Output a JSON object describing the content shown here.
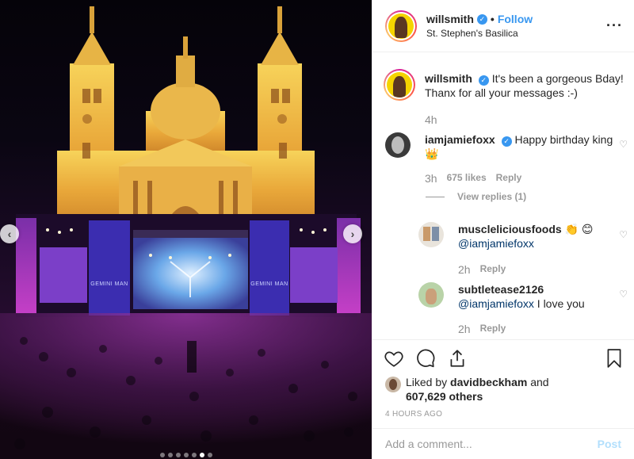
{
  "post": {
    "username": "willsmith",
    "follow_label": "Follow",
    "separator": "•",
    "location": "St. Stephen's Basilica",
    "more_label": "···"
  },
  "photo": {
    "stage_left_banner": "GEMINI MAN",
    "stage_right_banner": "GEMINI MAN",
    "slide_count": 7,
    "active_slide": 6,
    "prev_arrow": "‹",
    "next_arrow": "›"
  },
  "caption": {
    "username": "willsmith",
    "text": "It's been a gorgeous Bday! Thanx for all your messages :-)",
    "time": "4h"
  },
  "comments": [
    {
      "username": "iamjamiefoxx",
      "text": "Happy birthday king 👑",
      "time": "3h",
      "likes": "675 likes",
      "reply_label": "Reply",
      "view_replies": "View replies (1)"
    },
    {
      "username": "muscleliciousfoods",
      "text_emoji": "👏 😊",
      "mention": "@iamjamiefoxx",
      "time": "2h",
      "reply_label": "Reply"
    },
    {
      "username": "subtletease2126",
      "mention": "@iamjamiefoxx",
      "text": "I love you",
      "time": "2h",
      "reply_label": "Reply"
    }
  ],
  "likes": {
    "prefix": "Liked by",
    "user": "davidbeckham",
    "and": "and",
    "count": "607,629 others"
  },
  "timestamp": "4 HOURS AGO",
  "add_comment": {
    "placeholder": "Add a comment...",
    "post_label": "Post"
  },
  "colors": {
    "accent": "#3897f0",
    "post_disabled": "#b2dffc",
    "muted": "#999999"
  }
}
